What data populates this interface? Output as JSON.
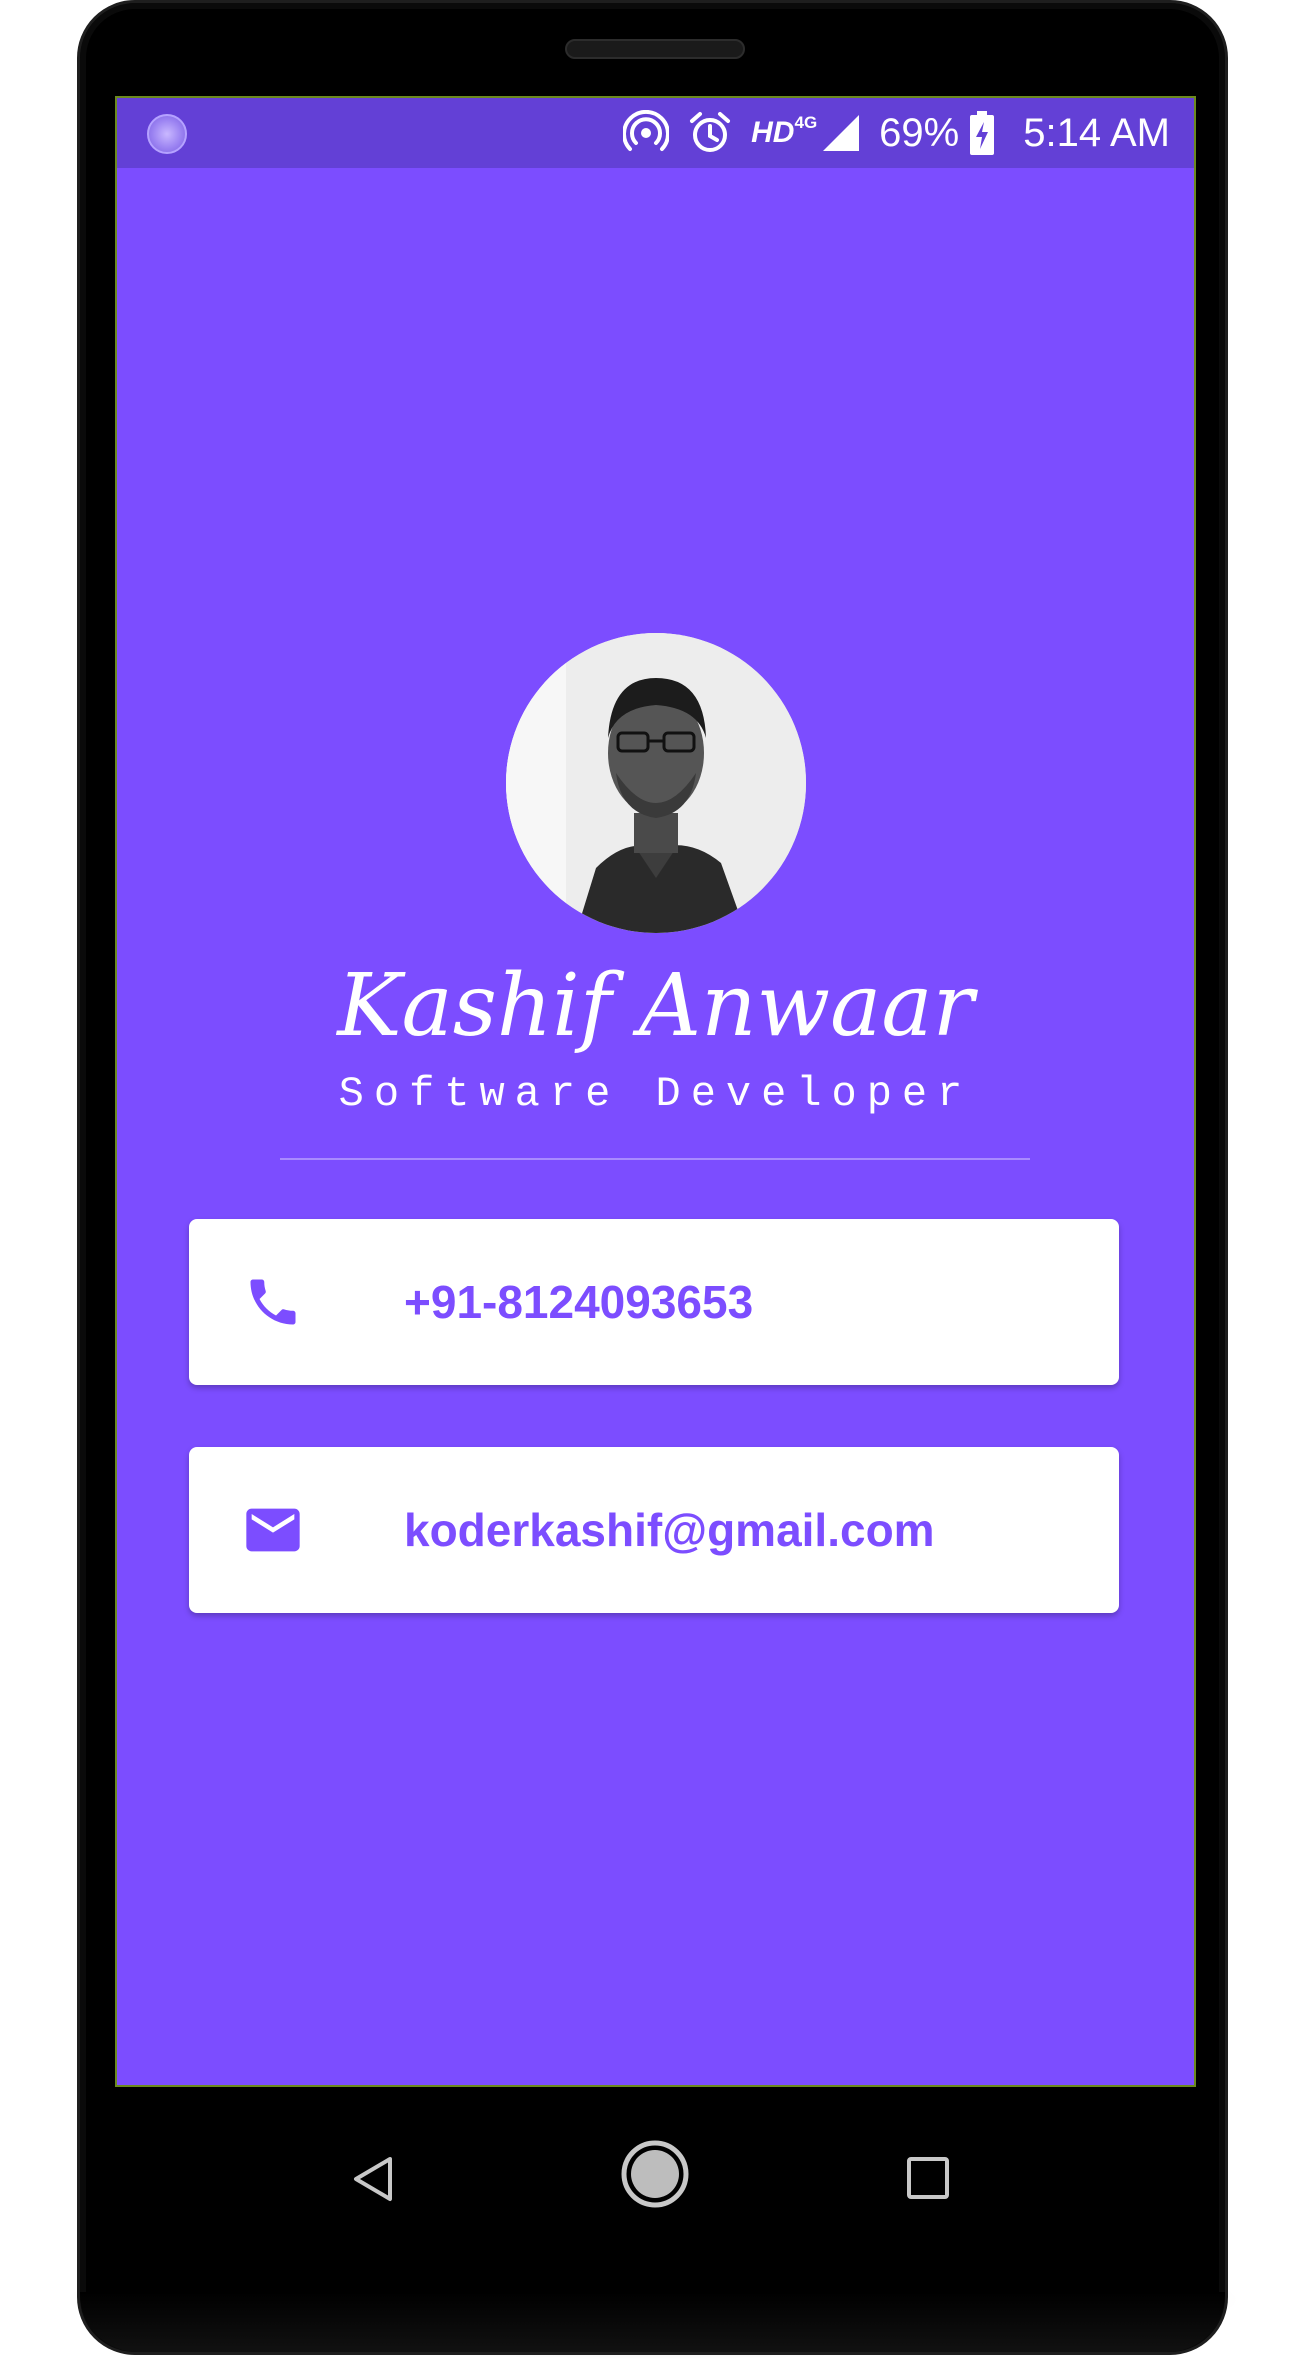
{
  "status_bar": {
    "network": "HD",
    "network_generation": "4G",
    "battery_percent": "69%",
    "time": "5:14 AM"
  },
  "profile": {
    "name": "Kashif Anwaar",
    "title": "Software Developer"
  },
  "contacts": {
    "phone": "+91-8124093653",
    "email": "koderkashif@gmail.com"
  },
  "colors": {
    "accent": "#7c4dff",
    "status_bar": "#6340d6",
    "card": "#ffffff"
  },
  "icons": {
    "status_left": "notification-app-icon",
    "hotspot": "hotspot-icon",
    "alarm": "alarm-icon",
    "signal": "signal-icon",
    "battery": "battery-charging-icon",
    "phone": "phone-icon",
    "email": "email-icon",
    "nav_back": "back-icon",
    "nav_home": "home-icon",
    "nav_recent": "recents-icon"
  }
}
